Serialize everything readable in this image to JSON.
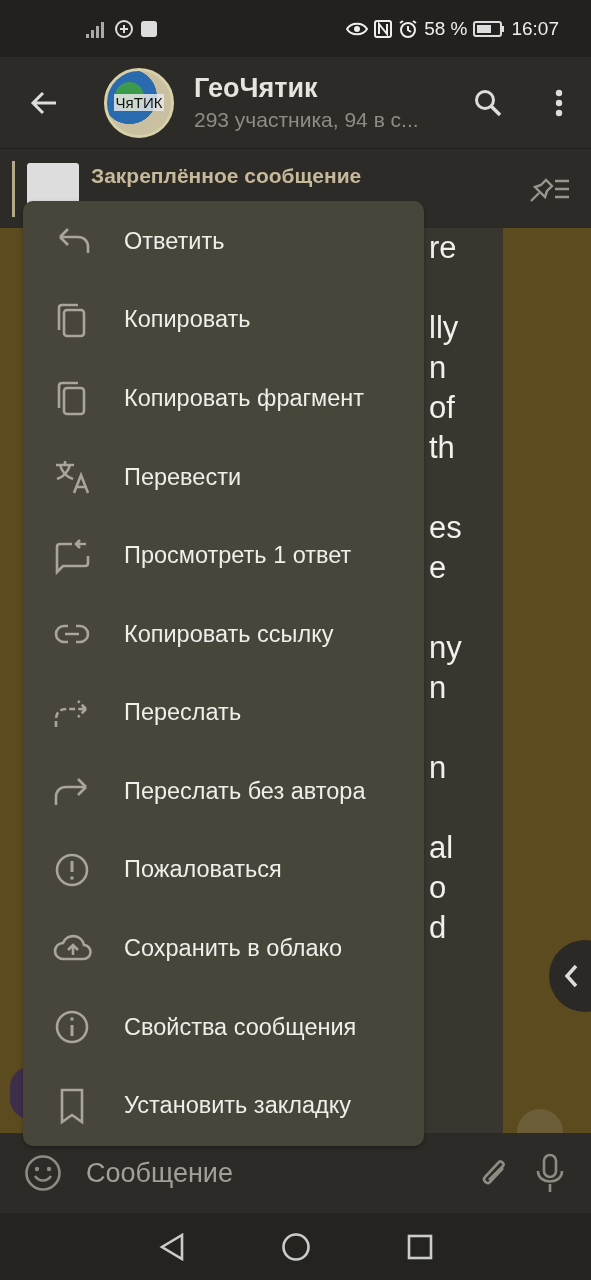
{
  "status_bar": {
    "battery": "58 %",
    "time": "16:07"
  },
  "header": {
    "title": "ГеоЧятик",
    "avatar_text": "ЧяТИК",
    "subtitle": "293 участника, 94 в с..."
  },
  "pinned": {
    "title": "Закреплённое сообщение"
  },
  "message": {
    "paragraphs": [
      [
        "re"
      ],
      [
        "lly",
        "n",
        "of",
        "th"
      ],
      [
        "es",
        "e"
      ],
      [
        "ny",
        "n"
      ],
      [
        "n"
      ],
      [
        "al",
        "o",
        "d"
      ]
    ]
  },
  "context_menu": [
    {
      "label": "Ответить"
    },
    {
      "label": "Копировать"
    },
    {
      "label": "Копировать фрагмент"
    },
    {
      "label": "Перевести"
    },
    {
      "label": "Просмотреть 1 ответ"
    },
    {
      "label": "Копировать ссылку"
    },
    {
      "label": "Переслать"
    },
    {
      "label": "Переслать без автора"
    },
    {
      "label": "Пожаловаться"
    },
    {
      "label": "Сохранить в облако"
    },
    {
      "label": "Свойства сообщения"
    },
    {
      "label": "Установить закладку"
    }
  ],
  "composer": {
    "placeholder": "Сообщение"
  }
}
